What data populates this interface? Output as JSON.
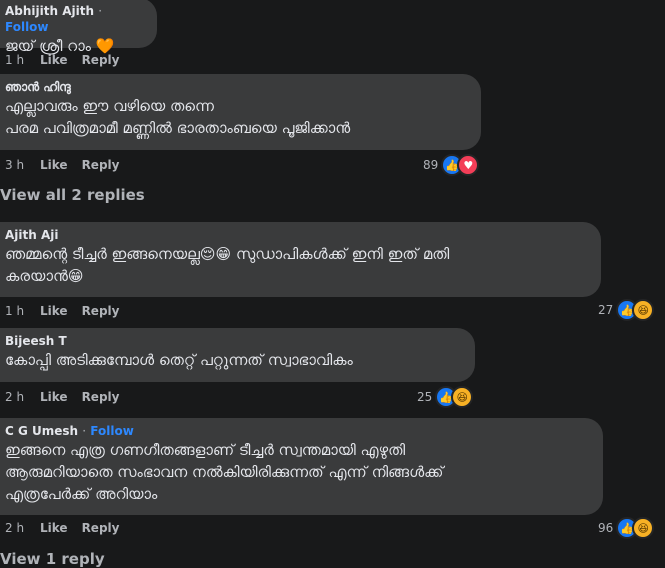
{
  "comments": [
    {
      "author": "Abhijith Ajith",
      "follow": "Follow",
      "text": "ജയ് ശ്രീ റാം 🧡",
      "time": "1 h",
      "like": "Like",
      "reply": "Reply"
    },
    {
      "author": "ഞാൻ ഹിന്ദു",
      "text": "എല്ലാവരും ഈ വഴിയെ തന്നെ\nപരമ പവിത്രമാമീ മണ്ണിൽ ഭാരതാംബയെ പൂജിക്കാൻ",
      "time": "3 h",
      "like": "Like",
      "reply": "Reply",
      "reactions": {
        "count": "89",
        "icons": [
          "like-icon",
          "love-icon"
        ]
      }
    },
    {
      "author": "Ajith Aji",
      "text": "ഞമ്മന്റെ ടീച്ചർ ഇങ്ങനെയല്ല😌😁 സുഡാപികൾക്ക് ഇനി ഇത് മതി\nകരയാൻ😁",
      "time": "1 h",
      "like": "Like",
      "reply": "Reply",
      "reactions": {
        "count": "27",
        "icons": [
          "like-icon",
          "haha-icon"
        ]
      }
    },
    {
      "author": "Bijeesh T",
      "text": "കോപ്പി അടിക്കുമ്പോൾ തെറ്റ് പറ്റുന്നത് സ്വാഭാവികം",
      "time": "2 h",
      "like": "Like",
      "reply": "Reply",
      "reactions": {
        "count": "25",
        "icons": [
          "like-icon",
          "haha-icon"
        ]
      }
    },
    {
      "author": "C G Umesh",
      "follow": "Follow",
      "text": "ഇങ്ങനെ എത്ര ഗണഗീതങ്ങളാണ് ടീച്ചർ സ്വന്തമായി എഴുതി\nആരുമറിയാതെ സംഭാവന നൽകിയിരിക്കുന്നത് എന്ന് നിങ്ങൾക്ക്\nഎത്രപേർക്ക് അറിയാം",
      "time": "2 h",
      "like": "Like",
      "reply": "Reply",
      "reactions": {
        "count": "96",
        "icons": [
          "like-icon",
          "haha-icon"
        ]
      }
    }
  ],
  "view_all_replies": "View all 2 replies",
  "view_replies": "View 1 reply",
  "separator": "·",
  "colors": {
    "background": "#18191a",
    "bubble": "#3a3b3c",
    "link": "#2d88ff",
    "muted": "#b0b3b8"
  }
}
